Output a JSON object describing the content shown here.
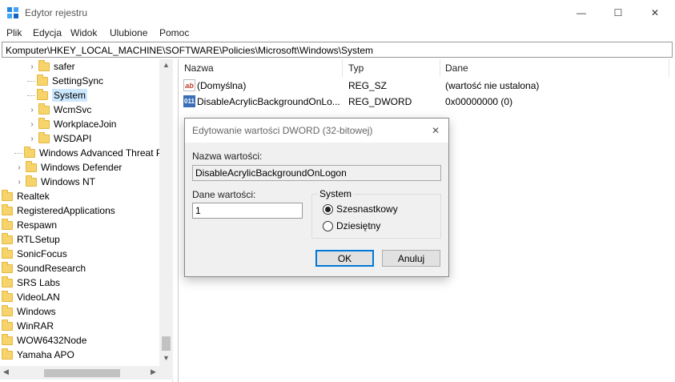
{
  "window": {
    "title": "Edytor rejestru",
    "min_glyph": "—",
    "max_glyph": "☐",
    "close_glyph": "✕"
  },
  "menu": [
    "Plik",
    "Edycja",
    "Widok",
    "Ulubione",
    "Pomoc"
  ],
  "address": "Komputer\\HKEY_LOCAL_MACHINE\\SOFTWARE\\Policies\\Microsoft\\Windows\\System",
  "tree": [
    {
      "label": "safer",
      "expander": "›"
    },
    {
      "label": "SettingSync",
      "expander": ""
    },
    {
      "label": "System",
      "expander": "",
      "selected": true
    },
    {
      "label": "WcmSvc",
      "expander": "›"
    },
    {
      "label": "WorkplaceJoin",
      "expander": "›"
    },
    {
      "label": "WSDAPI",
      "expander": "›"
    },
    {
      "label": "Windows Advanced Threat P",
      "expander": ""
    },
    {
      "label": "Windows Defender",
      "expander": "›"
    },
    {
      "label": "Windows NT",
      "expander": "›"
    },
    {
      "label": "Realtek",
      "expander": ""
    },
    {
      "label": "RegisteredApplications",
      "expander": ""
    },
    {
      "label": "Respawn",
      "expander": ""
    },
    {
      "label": "RTLSetup",
      "expander": ""
    },
    {
      "label": "SonicFocus",
      "expander": ""
    },
    {
      "label": "SoundResearch",
      "expander": ""
    },
    {
      "label": "SRS Labs",
      "expander": ""
    },
    {
      "label": "VideoLAN",
      "expander": ""
    },
    {
      "label": "Windows",
      "expander": ""
    },
    {
      "label": "WinRAR",
      "expander": ""
    },
    {
      "label": "WOW6432Node",
      "expander": ""
    },
    {
      "label": "Yamaha APO",
      "expander": ""
    }
  ],
  "list": {
    "columns": [
      "Nazwa",
      "Typ",
      "Dane"
    ],
    "rows": [
      {
        "icon": "string-value-icon",
        "icon_text": "ab",
        "name": "(Domyślna)",
        "type": "REG_SZ",
        "data": "(wartość nie ustalona)"
      },
      {
        "icon": "dword-value-icon",
        "icon_text": "011",
        "name": "DisableAcrylicBackgroundOnLo...",
        "type": "REG_DWORD",
        "data": "0x00000000 (0)"
      }
    ]
  },
  "dialog": {
    "title": "Edytowanie wartości DWORD (32-bitowej)",
    "close_glyph": "✕",
    "name_label": "Nazwa wartości:",
    "name_value": "DisableAcrylicBackgroundOnLogon",
    "data_label": "Dane wartości:",
    "data_value": "1",
    "base_label": "System",
    "radio_hex": "Szesnastkowy",
    "radio_dec": "Dziesiętny",
    "base_selected": "Szesnastkowy",
    "ok_label": "OK",
    "cancel_label": "Anuluj"
  },
  "colors": {
    "selection": "#cce8ff",
    "folder": "#f6d36b",
    "accent": "#0078d7"
  }
}
